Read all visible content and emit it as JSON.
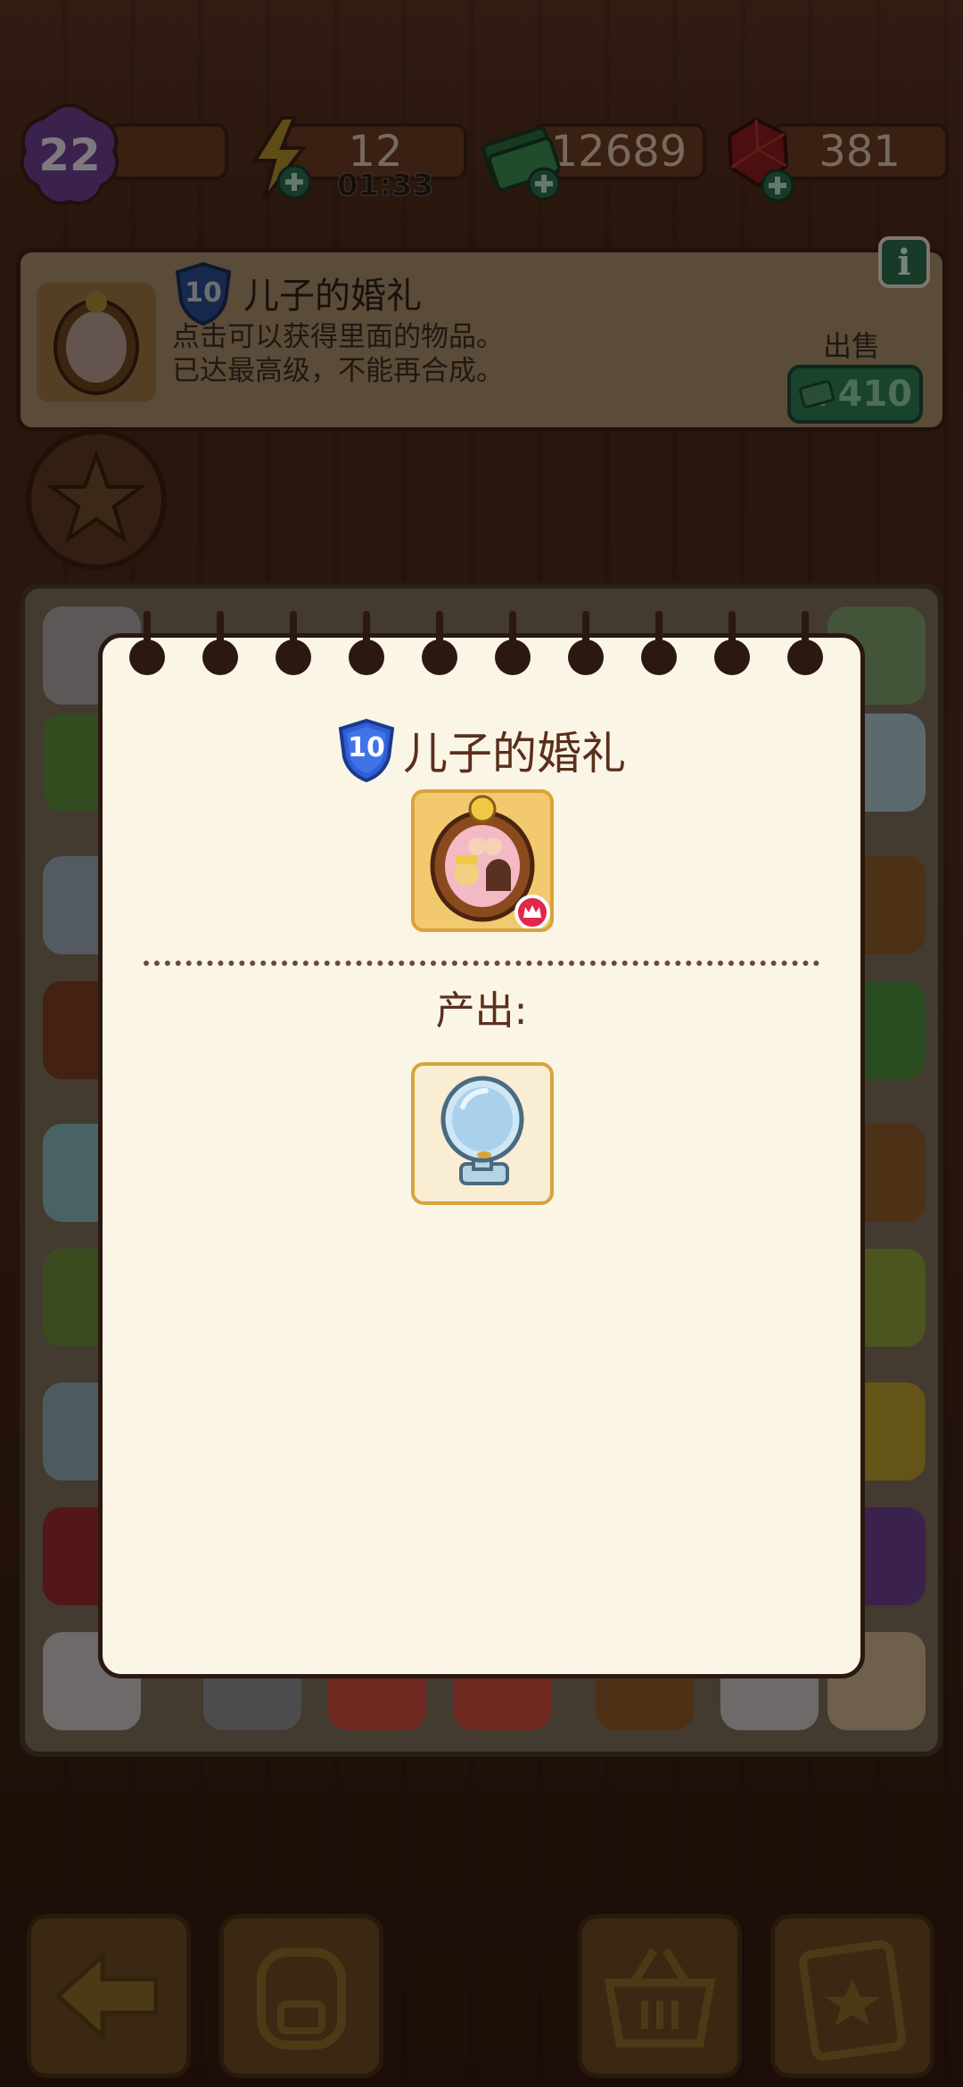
{
  "top_bar": {
    "level": "22",
    "energy": "12",
    "energy_timer": "01:33",
    "cash": "12689",
    "gems": "381"
  },
  "info_panel": {
    "level_badge": "10",
    "title": "儿子的婚礼",
    "description_line1": "点击可以获得里面的物品。",
    "description_line2": "已达最高级，不能再合成。",
    "sell_label": "出售",
    "sell_amount": "+410",
    "info_button": "i"
  },
  "modal": {
    "level_badge": "10",
    "title": "儿子的婚礼",
    "produce_label": "产出:",
    "item_icon": "wedding-photo-frame",
    "produced_icon": "hand-mirror"
  },
  "bottom_bar": {
    "icons": [
      "back-arrow-icon",
      "backpack-icon",
      "basket-icon",
      "clipboard-star-icon"
    ]
  },
  "colors": {
    "modal_bg": "#fbf5e6",
    "accent_gold": "#d7a43c",
    "shield_blue": "#2f5fd6",
    "sell_green": "#2f7a53"
  }
}
